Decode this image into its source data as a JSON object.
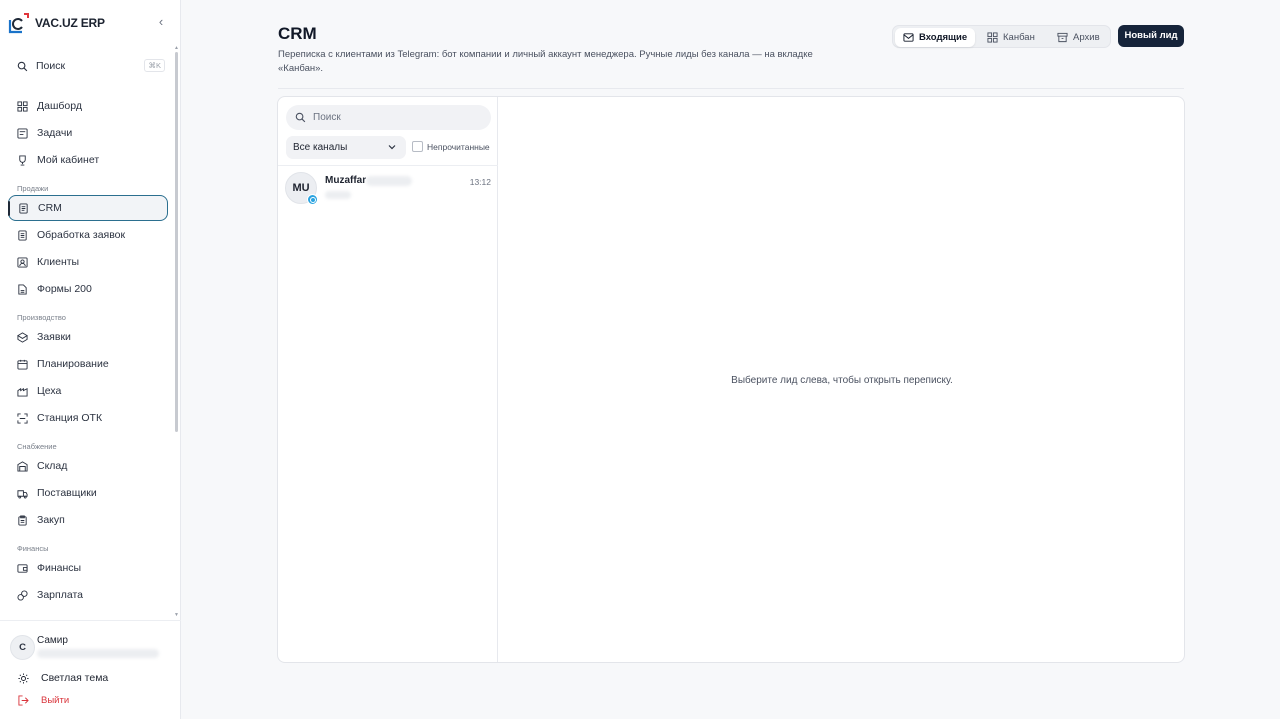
{
  "brand": {
    "title": "VAC.UZ ERP",
    "accent": "#1a73c9",
    "accent2": "#e0343b"
  },
  "sidebar": {
    "search": {
      "label": "Поиск",
      "shortcut": "⌘K"
    },
    "items": [
      {
        "label": "Дашборд",
        "icon": "dashboard-icon"
      },
      {
        "label": "Задачи",
        "icon": "tasks-icon"
      },
      {
        "label": "Мой кабинет",
        "icon": "trophy-icon"
      }
    ],
    "sections": [
      {
        "title": "Продажи",
        "items": [
          {
            "label": "CRM",
            "icon": "crm-icon",
            "active": true
          },
          {
            "label": "Обработка заявок",
            "icon": "requests-processing-icon"
          },
          {
            "label": "Клиенты",
            "icon": "clients-icon"
          },
          {
            "label": "Формы 200",
            "icon": "forms-icon"
          }
        ]
      },
      {
        "title": "Производство",
        "items": [
          {
            "label": "Заявки",
            "icon": "orders-icon"
          },
          {
            "label": "Планирование",
            "icon": "calendar-icon"
          },
          {
            "label": "Цеха",
            "icon": "factory-icon"
          },
          {
            "label": "Станция ОТК",
            "icon": "scan-icon"
          }
        ]
      },
      {
        "title": "Снабжение",
        "items": [
          {
            "label": "Склад",
            "icon": "warehouse-icon"
          },
          {
            "label": "Поставщики",
            "icon": "truck-icon"
          },
          {
            "label": "Закуп",
            "icon": "clipboard-icon"
          }
        ]
      },
      {
        "title": "Финансы",
        "items": [
          {
            "label": "Финансы",
            "icon": "wallet-icon"
          },
          {
            "label": "Зарплата",
            "icon": "coins-icon"
          }
        ]
      }
    ],
    "user": {
      "initial": "С",
      "name": "Самир"
    },
    "theme_label": "Светлая тема",
    "logout_label": "Выйти",
    "logout_color": "#d9343b"
  },
  "header": {
    "title": "CRM",
    "description": "Переписка с клиентами из Telegram: бот компании и личный аккаунт менеджера. Ручные лиды без канала — на вкладке «Канбан».",
    "tabs": [
      {
        "label": "Входящие",
        "icon": "mail-icon",
        "active": true
      },
      {
        "label": "Канбан",
        "icon": "kanban-icon"
      },
      {
        "label": "Архив",
        "icon": "archive-icon"
      }
    ],
    "new_lead_label": "Новый лид",
    "new_lead_color": "#16243a"
  },
  "inbox": {
    "search_placeholder": "Поиск",
    "channel_filter": "Все каналы",
    "unread_label": "Непрочитанные",
    "unread_checked": false,
    "conversations": [
      {
        "initials": "MU",
        "name": "Muzaffar",
        "time": "13:12",
        "channel": "telegram-icon"
      }
    ],
    "empty_message": "Выберите лид слева, чтобы открыть переписку."
  }
}
